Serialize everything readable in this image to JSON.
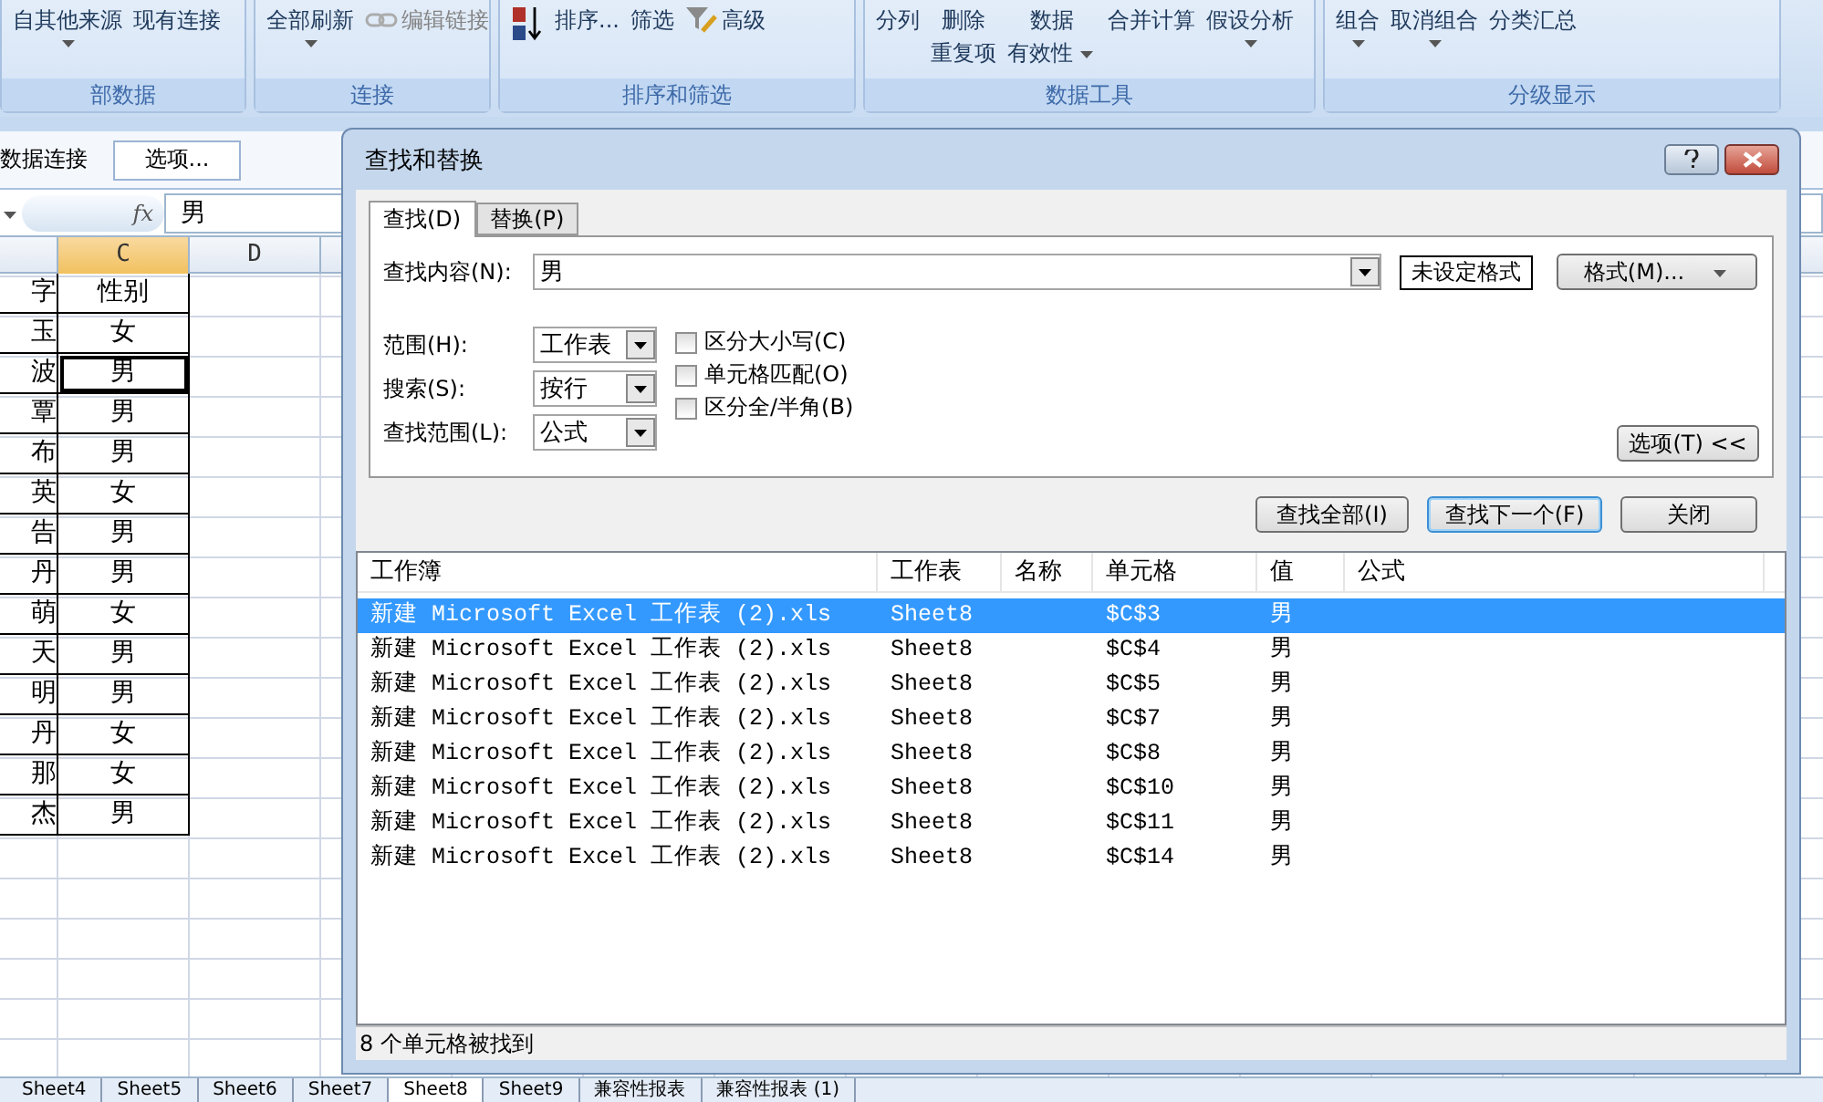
{
  "ribbon": {
    "groups": [
      {
        "label": "部数据",
        "buttons": [
          {
            "kind": "text",
            "lines": [
              "自其他来源"
            ],
            "dropdown": true,
            "disabled": false
          },
          {
            "kind": "text",
            "lines": [
              "现有连接"
            ],
            "dropdown": false,
            "disabled": false
          }
        ]
      },
      {
        "label": "连接",
        "buttons": [
          {
            "kind": "text",
            "lines": [
              "全部刷新"
            ],
            "dropdown": true,
            "disabled": false
          },
          {
            "kind": "link",
            "lines": [
              "编辑链接"
            ],
            "dropdown": false,
            "disabled": true
          }
        ]
      },
      {
        "label": "排序和筛选",
        "buttons": [
          {
            "kind": "sort",
            "dropdown": false,
            "disabled": false
          },
          {
            "kind": "text",
            "lines": [
              "排序..."
            ],
            "dropdown": false,
            "disabled": false
          },
          {
            "kind": "text",
            "lines": [
              "筛选"
            ],
            "dropdown": false,
            "disabled": false
          },
          {
            "kind": "filter",
            "lines": [
              "高级"
            ],
            "dropdown": false,
            "disabled": false
          }
        ]
      },
      {
        "label": "数据工具",
        "buttons": [
          {
            "kind": "text",
            "lines": [
              "分列"
            ],
            "dropdown": false,
            "disabled": false
          },
          {
            "kind": "text",
            "lines": [
              "删除",
              "重复项"
            ],
            "dropdown": false,
            "disabled": false
          },
          {
            "kind": "text",
            "lines": [
              "数据",
              "有效性"
            ],
            "dropdown": true,
            "disabled": false
          },
          {
            "kind": "text",
            "lines": [
              "合并计算"
            ],
            "dropdown": false,
            "disabled": false
          },
          {
            "kind": "text",
            "lines": [
              "假设分析"
            ],
            "dropdown": true,
            "disabled": false
          }
        ]
      },
      {
        "label": "分级显示",
        "buttons": [
          {
            "kind": "text",
            "lines": [
              "组合"
            ],
            "dropdown": true,
            "disabled": false
          },
          {
            "kind": "text",
            "lines": [
              "取消组合"
            ],
            "dropdown": true,
            "disabled": false
          },
          {
            "kind": "text",
            "lines": [
              "分类汇总"
            ],
            "dropdown": false,
            "disabled": false
          }
        ]
      }
    ]
  },
  "message_bar": {
    "text": "数据连接",
    "button": "选项..."
  },
  "formula_bar": {
    "function_label": "fx",
    "value": "男"
  },
  "sheet": {
    "columns": [
      {
        "label": "C",
        "selected": true
      },
      {
        "label": "D",
        "selected": false
      }
    ],
    "rows": [
      {
        "b": "字",
        "c": "性别",
        "selected": false
      },
      {
        "b": "玉",
        "c": "女",
        "selected": false
      },
      {
        "b": "波",
        "c": "男",
        "selected": true
      },
      {
        "b": "覃",
        "c": "男",
        "selected": false
      },
      {
        "b": "布",
        "c": "男",
        "selected": false
      },
      {
        "b": "英",
        "c": "女",
        "selected": false
      },
      {
        "b": "告",
        "c": "男",
        "selected": false
      },
      {
        "b": "丹",
        "c": "男",
        "selected": false
      },
      {
        "b": "萌",
        "c": "女",
        "selected": false
      },
      {
        "b": "天",
        "c": "男",
        "selected": false
      },
      {
        "b": "明",
        "c": "男",
        "selected": false
      },
      {
        "b": "丹",
        "c": "女",
        "selected": false
      },
      {
        "b": "那",
        "c": "女",
        "selected": false
      },
      {
        "b": "杰",
        "c": "男",
        "selected": false
      }
    ]
  },
  "dialog": {
    "title": "查找和替换",
    "tabs": [
      {
        "label": "查找(D)",
        "selected": true
      },
      {
        "label": "替换(P)",
        "selected": false
      }
    ],
    "find_label": "查找内容(N):",
    "find_value": "男",
    "format_status": "未设定格式",
    "format_button": "格式(M)...",
    "options": [
      {
        "label": "范围(H):",
        "value": "工作表"
      },
      {
        "label": "搜索(S):",
        "value": "按行"
      },
      {
        "label": "查找范围(L):",
        "value": "公式"
      }
    ],
    "checkboxes": [
      {
        "label": "区分大小写(C)",
        "checked": false
      },
      {
        "label": "单元格匹配(O)",
        "checked": false
      },
      {
        "label": "区分全/半角(B)",
        "checked": false
      }
    ],
    "options_button": "选项(T) <<",
    "buttons": [
      {
        "label": "查找全部(I)",
        "focused": false
      },
      {
        "label": "查找下一个(F)",
        "focused": true
      },
      {
        "label": "关闭",
        "focused": false
      }
    ],
    "results": {
      "columns": [
        "工作簿",
        "工作表",
        "名称",
        "单元格",
        "值",
        "公式"
      ],
      "rows": [
        {
          "workbook": "新建 Microsoft Excel 工作表 (2).xls",
          "sheet": "Sheet8",
          "cell": "$C$3",
          "value": "男",
          "selected": true
        },
        {
          "workbook": "新建 Microsoft Excel 工作表 (2).xls",
          "sheet": "Sheet8",
          "cell": "$C$4",
          "value": "男",
          "selected": false
        },
        {
          "workbook": "新建 Microsoft Excel 工作表 (2).xls",
          "sheet": "Sheet8",
          "cell": "$C$5",
          "value": "男",
          "selected": false
        },
        {
          "workbook": "新建 Microsoft Excel 工作表 (2).xls",
          "sheet": "Sheet8",
          "cell": "$C$7",
          "value": "男",
          "selected": false
        },
        {
          "workbook": "新建 Microsoft Excel 工作表 (2).xls",
          "sheet": "Sheet8",
          "cell": "$C$8",
          "value": "男",
          "selected": false
        },
        {
          "workbook": "新建 Microsoft Excel 工作表 (2).xls",
          "sheet": "Sheet8",
          "cell": "$C$10",
          "value": "男",
          "selected": false
        },
        {
          "workbook": "新建 Microsoft Excel 工作表 (2).xls",
          "sheet": "Sheet8",
          "cell": "$C$11",
          "value": "男",
          "selected": false
        },
        {
          "workbook": "新建 Microsoft Excel 工作表 (2).xls",
          "sheet": "Sheet8",
          "cell": "$C$14",
          "value": "男",
          "selected": false
        }
      ]
    },
    "status": "8 个单元格被找到"
  },
  "sheet_tabs": [
    {
      "label": "Sheet4",
      "selected": false
    },
    {
      "label": "Sheet5",
      "selected": false
    },
    {
      "label": "Sheet6",
      "selected": false
    },
    {
      "label": "Sheet7",
      "selected": false
    },
    {
      "label": "Sheet8",
      "selected": true
    },
    {
      "label": "Sheet9",
      "selected": false
    },
    {
      "label": "兼容性报表",
      "selected": false
    },
    {
      "label": "兼容性报表 (1)",
      "selected": false
    }
  ]
}
